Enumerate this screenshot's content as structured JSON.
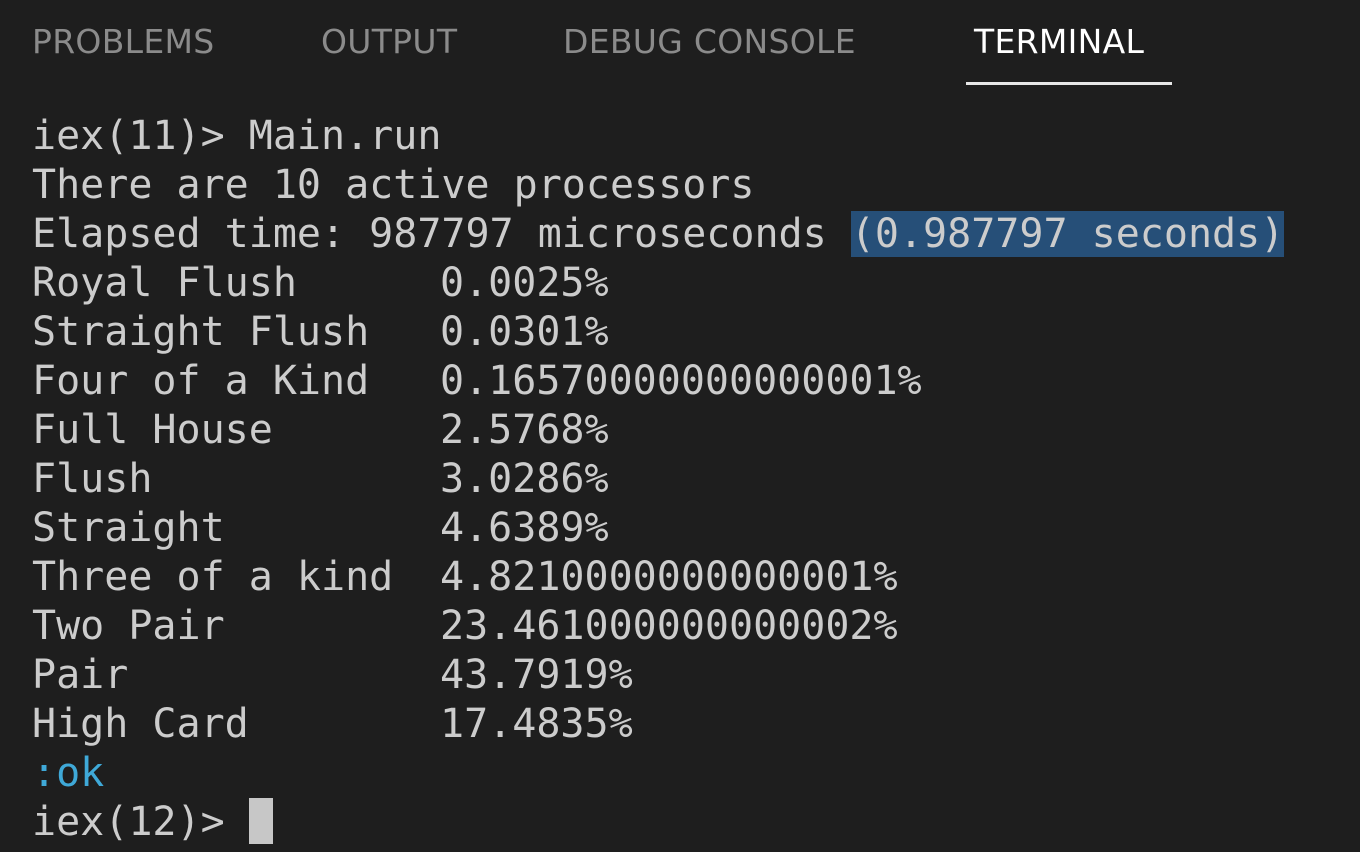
{
  "tabs": [
    {
      "label": "PROBLEMS"
    },
    {
      "label": "OUTPUT"
    },
    {
      "label": "DEBUG CONSOLE"
    },
    {
      "label": "TERMINAL",
      "active": true
    }
  ],
  "terminal": {
    "command_line": "iex(11)> Main.run",
    "info_line": "There are 10 active processors",
    "elapsed_prefix": "Elapsed time: 987797 microseconds ",
    "elapsed_selected": "(0.987797 seconds)",
    "results": [
      {
        "hand": "Royal Flush",
        "percent": "0.0025%"
      },
      {
        "hand": "Straight Flush",
        "percent": "0.0301%"
      },
      {
        "hand": "Four of a Kind",
        "percent": "0.16570000000000001%"
      },
      {
        "hand": "Full House",
        "percent": "2.5768%"
      },
      {
        "hand": "Flush",
        "percent": "3.0286%"
      },
      {
        "hand": "Straight",
        "percent": "4.6389%"
      },
      {
        "hand": "Three of a kind",
        "percent": "4.8210000000000001%"
      },
      {
        "hand": "Two Pair",
        "percent": "23.461000000000002%"
      },
      {
        "hand": "Pair",
        "percent": "43.7919%"
      },
      {
        "hand": "High Card",
        "percent": "17.4835%"
      }
    ],
    "return_value": ":ok",
    "prompt": "iex(12)> "
  },
  "colors": {
    "background": "#1e1e1e",
    "text": "#cccccc",
    "selection": "#264f78",
    "atom": "#3fa9d8",
    "tab_inactive": "#8b8b8b",
    "tab_active": "#ffffff"
  }
}
